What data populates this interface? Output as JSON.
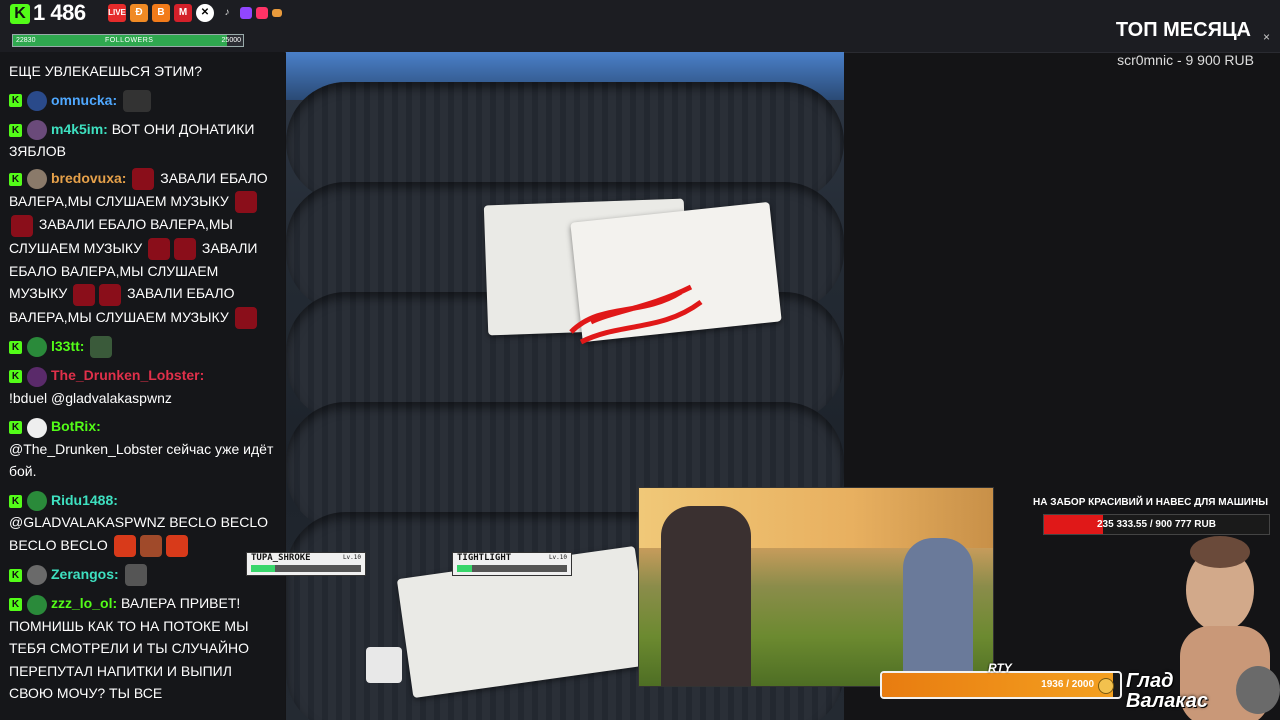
{
  "topbar": {
    "viewer_count": "1 486",
    "followers_start": "22830",
    "followers_label": "FOLLOWERS",
    "followers_goal": "25000",
    "followers_progress": 0.93,
    "icons": [
      "kick-icon",
      "live-icon",
      "donation-icon",
      "boosty-icon",
      "monster-icon",
      "x-icon",
      "tiktok-icon",
      "twitch-icon",
      "youtube-icon",
      "flag-icon"
    ],
    "live_label": "LIVE"
  },
  "top_month": {
    "title": "ТОП МЕСЯЦА",
    "value": "scr0mnic - 9 900 RUB",
    "close": "×"
  },
  "chat": {
    "messages": [
      {
        "user": "",
        "text": "ЕЩЕ УВЛЕКАЕШЬСЯ ЭТИМ?"
      },
      {
        "user": "omnucka:",
        "color": "#4fa8ff",
        "text": ""
      },
      {
        "user": "m4k5im:",
        "color": "#3ee0c0",
        "text": "ВОТ ОНИ ДОНАТИКИ ЗЯБЛОВ"
      },
      {
        "user": "bredovuxa:",
        "color": "#e6a14a",
        "text": "ЗАВАЛИ ЕБАЛО ВАЛЕРА,МЫ СЛУШАЕМ МУЗЫКУ",
        "text2": "ЗАВАЛИ ЕБАЛО ВАЛЕРА,МЫ СЛУШАЕМ МУЗЫКУ",
        "text3": "ЗАВАЛИ ЕБАЛО ВАЛЕРА,МЫ СЛУШАЕМ МУЗЫКУ",
        "text4": "ЗАВАЛИ ЕБАЛО ВАЛЕРА,МЫ СЛУШАЕМ МУЗЫКУ"
      },
      {
        "user": "l33tt:",
        "color": "#53fc18",
        "text": ""
      },
      {
        "user": "The_Drunken_Lobster:",
        "color": "#e0304a",
        "text": "!bduel @gladvalakaspwnz"
      },
      {
        "user": "BotRix:",
        "color": "#53fc18",
        "text": "@The_Drunken_Lobster сейчас уже идёт бой."
      },
      {
        "user": "Ridu1488:",
        "color": "#3ee0c0",
        "text": "@GLADVALAKASPWNZ BECLO BECLO BECLO BECLO"
      },
      {
        "user": "Zerangos:",
        "color": "#3ee0c0",
        "text": ""
      },
      {
        "user": "zzz_lo_ol:",
        "color": "#53fc18",
        "text": "ВАЛЕРА ПРИВЕТ! ПОМНИШЬ КАК ТО НА ПОТОКЕ МЫ ТЕБЯ СМОТРЕЛИ И ТЫ СЛУЧАЙНО ПЕРЕПУТАЛ НАПИТКИ И ВЫПИЛ СВОЮ МОЧУ? ТЫ ВСЕ"
      }
    ]
  },
  "overlays": {
    "hp1_name": "TUPA_SHROKE",
    "hp1_lv": "Lv.10",
    "hp1_label": "HP:",
    "hp2_name": "TIGHTLIGHT",
    "hp2_lv": "Lv.10",
    "hp2_label": "HP:",
    "goal_title": "НА ЗАБОР КРАСИВИЙ И НАВЕС ДЛЯ МАШИНЫ",
    "goal_value": "235 333.55 / 900 777 RUB",
    "goal_progress": 0.26,
    "xp_value": "1936 / 2000",
    "xp_progress": 0.97,
    "xp_partial_label": "RTY",
    "streamer_name_1": "Глад",
    "streamer_name_2": "Валакас"
  },
  "colors": {
    "accent": "#53fc18",
    "danger": "#e01818"
  }
}
